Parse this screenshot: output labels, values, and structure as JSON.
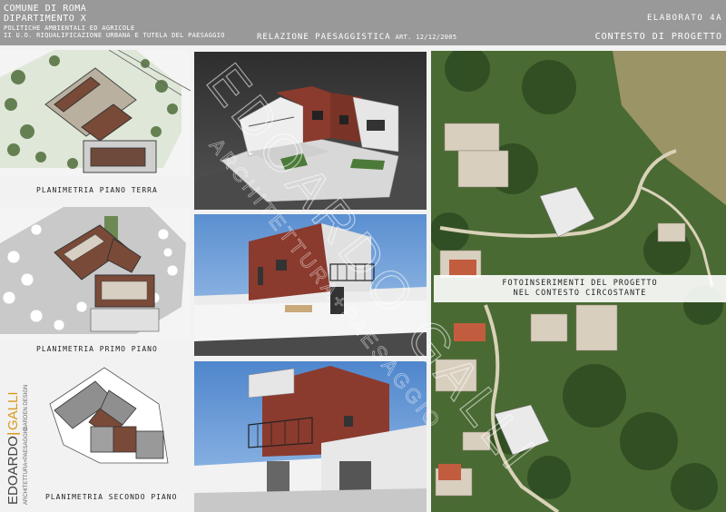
{
  "header": {
    "org_line1": "COMUNE DI ROMA",
    "org_line2": "DIPARTIMENTO X",
    "org_line3": "POLITICHE AMBIENTALI ED AGRICOLE",
    "org_line4": "II U.O. RIQUALIFICAZIONE URBANA E TUTELA DEL PAESAGGIO",
    "doc_title": "RELAZIONE PAESAGGISTICA",
    "doc_date": "ART. 12/12/2005",
    "sheet_number": "ELABORATO 4A",
    "sheet_title": "CONTESTO DI PROGETTO"
  },
  "plans": [
    {
      "caption": "PLANIMETRIA PIANO TERRA"
    },
    {
      "caption": "PLANIMETRIA PRIMO PIANO"
    },
    {
      "caption": "PLANIMETRIA SECONDO PIANO"
    }
  ],
  "aerial": {
    "label_line1": "FOTOINSERIMENTI DEL PROGETTO",
    "label_line2": "NEL CONTESTO CIRCOSTANTE"
  },
  "logo": {
    "name_part1": "EDOARDO",
    "name_part2": "GALLI",
    "sub1": "ARCHITETTURA+PAESAGGIO",
    "sub2": "GARDEN DESIGN"
  },
  "watermark": {
    "text1": "EDOARDO GALLI",
    "text2": "ARCHITETTURA+PAESAGGIO"
  },
  "colors": {
    "header_bg": "#999999",
    "brick": "#8b3a2e",
    "vegetation": "#3e5f2e",
    "logo_accent": "#d99a1e"
  }
}
